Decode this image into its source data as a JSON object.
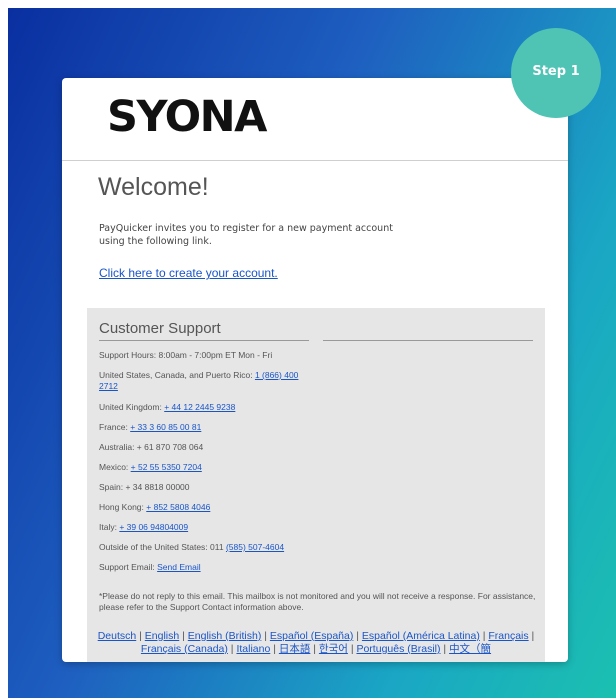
{
  "step_badge": "Step 1",
  "brand": {
    "logo_text": "SYONA"
  },
  "welcome": {
    "title": "Welcome!",
    "intro": "PayQuicker invites you to register for a new payment account using the following link.",
    "create_link": "Click here to create your account."
  },
  "support": {
    "title": "Customer Support",
    "hours": "Support Hours: 8:00am - 7:00pm ET Mon - Fri",
    "rows": [
      {
        "label": "United States, Canada, and Puerto Rico: ",
        "link": "1 (866) 400 2712"
      },
      {
        "label": "United Kingdom: ",
        "link": "+ 44 12 2445 9238"
      },
      {
        "label": "France: ",
        "link": "+ 33 3 60 85 00 81"
      },
      {
        "label": "Australia: + 61 870 708 064",
        "link": ""
      },
      {
        "label": "Mexico: ",
        "link": "+ 52 55 5350 7204"
      },
      {
        "label": "Spain: + 34 8818 00000",
        "link": ""
      },
      {
        "label": "Hong Kong: ",
        "link": "+ 852 5808 4046"
      },
      {
        "label": "Italy: ",
        "link": "+ 39 06 94804009"
      },
      {
        "label": "Outside of the United States: 011 ",
        "link": "(585) 507-4604"
      },
      {
        "label": "Support Email: ",
        "link": "Send Email"
      }
    ],
    "disclaimer": "*Please do not reply to this email. This mailbox is not monitored and you will not receive a response. For assistance, please refer to the Support Contact information above."
  },
  "languages": [
    "Deutsch",
    "English",
    "English (British)",
    "Español (España)",
    "Español (América Latina)",
    "Français",
    "Français (Canada)",
    "Italiano",
    "日本語",
    "한국어",
    "Português (Brasil)",
    "中文（簡"
  ],
  "language_separator": " | "
}
